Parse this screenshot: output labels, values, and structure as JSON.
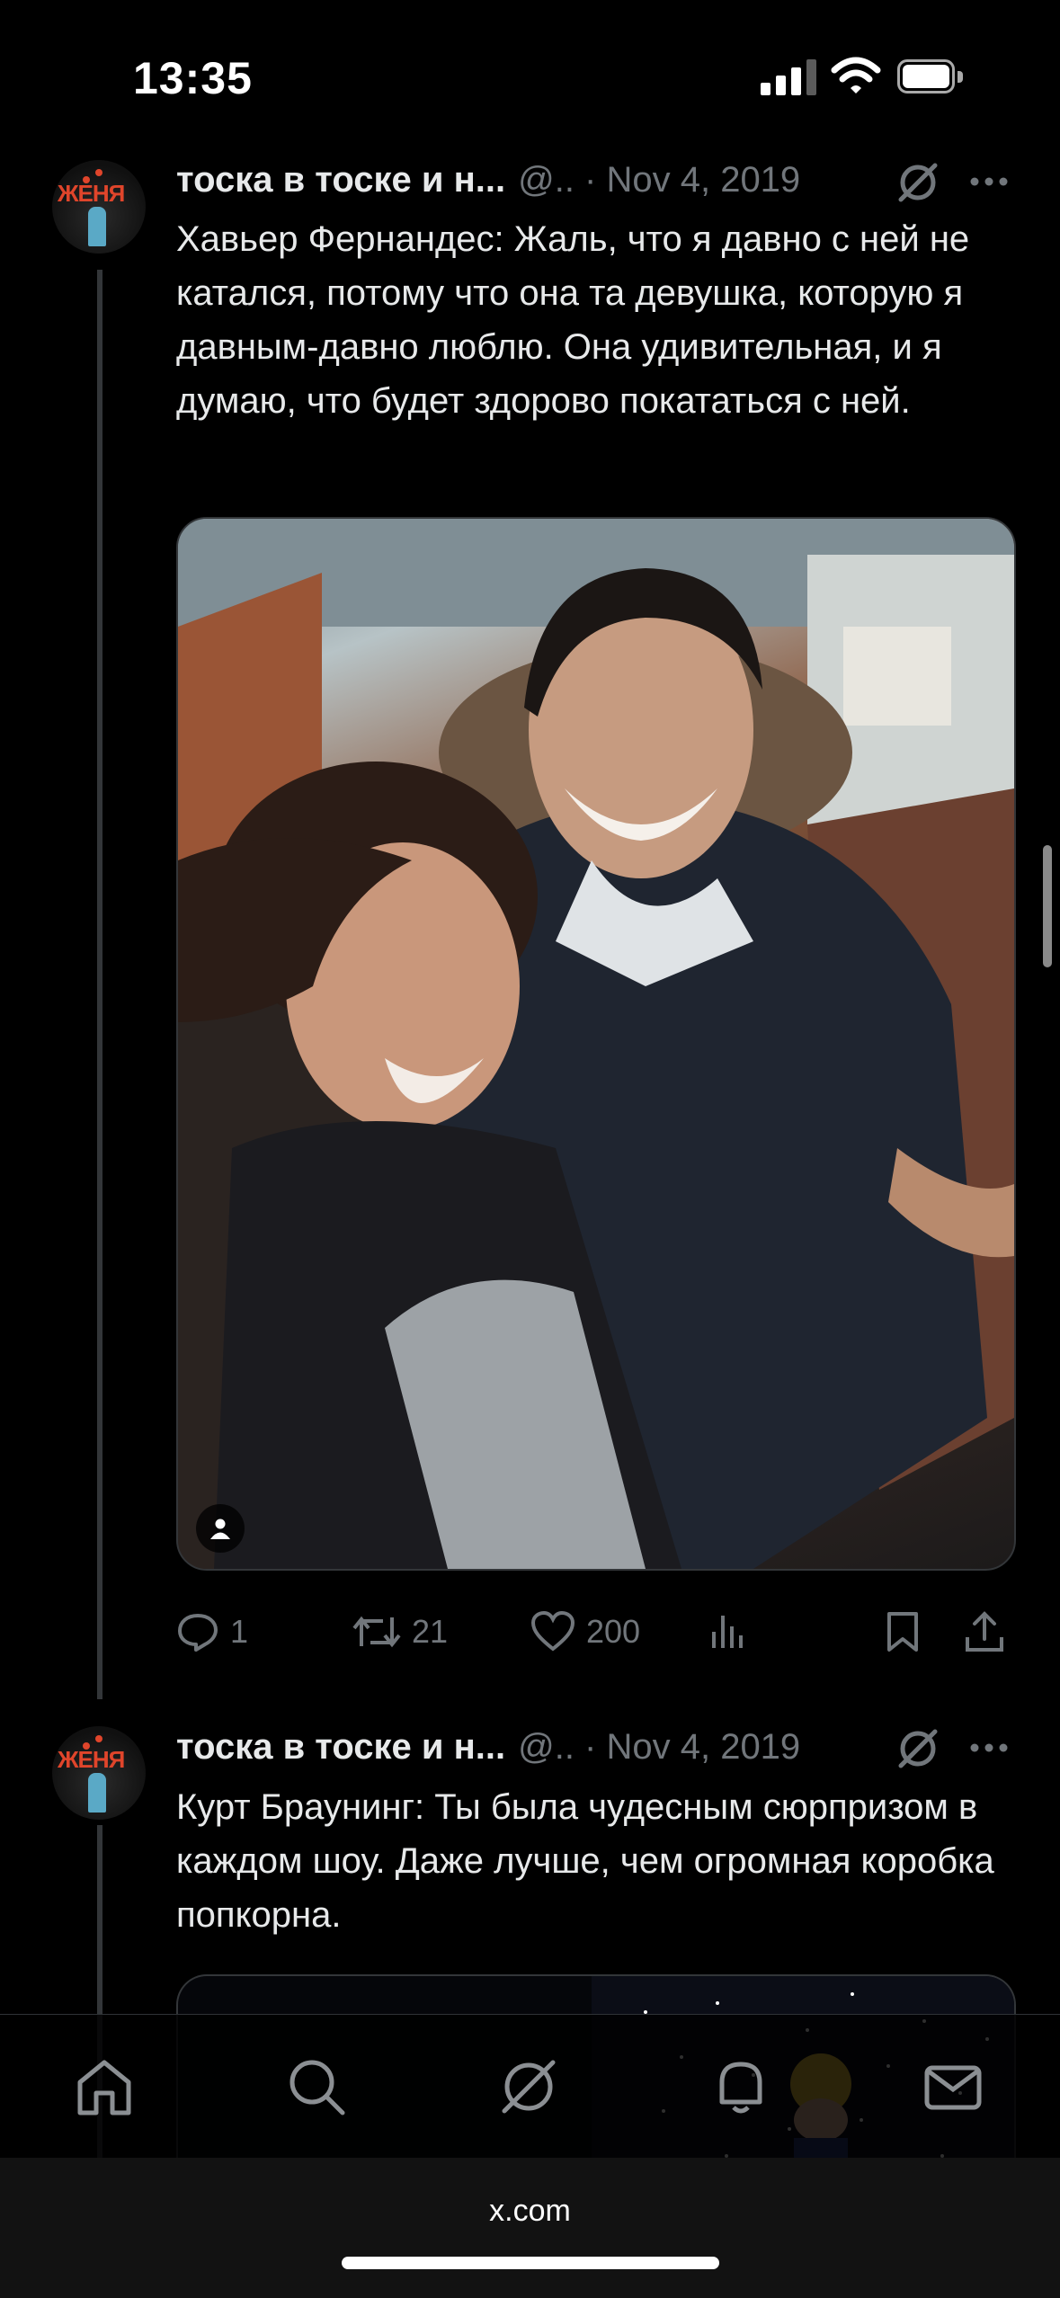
{
  "status_bar": {
    "time": "13:35"
  },
  "tweets": [
    {
      "avatar_text": "ЖЕНЯ",
      "name": "тоска в тоске и н...",
      "meta": "@.. · Nov 4, 2019",
      "text": "Хавьер Фернандес: Жаль, что я давно с ней не катался, потому что она та девушка, которую я давным-давно люблю. Она удивительная, и я думаю, что будет здорово покататься с ней.",
      "stats": {
        "replies": "1",
        "reposts": "21",
        "likes": "200"
      }
    },
    {
      "avatar_text": "ЖЕНЯ",
      "name": "тоска в тоске и н...",
      "meta": "@.. · Nov 4, 2019",
      "text": "Курт Браунинг: Ты была чудесным сюрпризом в каждом шоу. Даже лучше, чем огромная коробка попкорна."
    }
  ],
  "browser": {
    "url": "x.com"
  },
  "colors": {
    "background": "#000000",
    "text": "#e7e9ea",
    "muted": "#71767b",
    "divider": "#2f3336"
  },
  "icons": [
    "signal-icon",
    "wifi-icon",
    "battery-icon",
    "grok-icon",
    "more-icon",
    "reply-icon",
    "repost-icon",
    "like-icon",
    "views-icon",
    "bookmark-icon",
    "share-icon",
    "home-icon",
    "search-icon",
    "notifications-icon",
    "messages-icon",
    "user-tag-icon"
  ]
}
